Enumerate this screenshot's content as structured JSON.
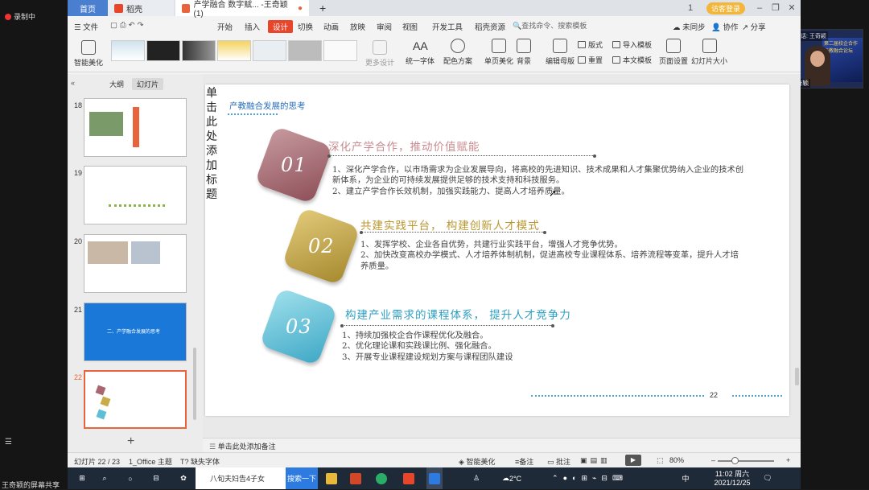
{
  "meeting": {
    "recording_label": "录制中",
    "share_label": "王奇颖的屏幕共享",
    "speaking_label": "正在讲话: 王奇颖",
    "participant_name": "王奇颖",
    "poster_text": "第二届校企合作 产教融合论坛"
  },
  "window": {
    "tabs": [
      "首页",
      "稻壳",
      "产学融合 数字赋... -王奇颖(1)"
    ],
    "login": "访客登录",
    "page_count_badge": "1"
  },
  "menu": {
    "items": [
      "文件",
      "开始",
      "插入",
      "设计",
      "切换",
      "动画",
      "放映",
      "审阅",
      "视图",
      "开发工具",
      "稻壳资源"
    ],
    "search": "查找命令、搜索模板",
    "right": [
      "未同步",
      "协作",
      "分享"
    ]
  },
  "ribbon": {
    "smart": "智能美化",
    "more": "更多设计",
    "font": "统一字体",
    "color": "配色方案",
    "single": "单页美化",
    "bg": "背景",
    "master": "编辑母版",
    "layout": "版式",
    "import": "导入模板",
    "reset": "重置",
    "text_tpl": "本文模板",
    "page_setup": "页面设置",
    "slide_size": "幻灯片大小"
  },
  "pane": {
    "tab_outline": "大纲",
    "tab_slides": "幻灯片",
    "slides": [
      {
        "num": "18"
      },
      {
        "num": "19"
      },
      {
        "num": "20"
      },
      {
        "num": "21",
        "text": "二、产学融合发展的思考"
      },
      {
        "num": "22"
      }
    ]
  },
  "slide": {
    "title_placeholder": "单击此处添加标题",
    "heading": "产教融合发展的思考",
    "sections": [
      {
        "num": "01",
        "title": "深化产学合作，推动价值赋能",
        "lines": [
          "1、深化产学合作，以市场需求为企业发展导向，将高校的先进知识、技术成果和人才集聚优势纳入企业的技术创新体系，为企业的可持续发展提供足够的技术支持和科技服务。",
          "2、建立产学合作长效机制，加强实践能力、提高人才培养质量。"
        ]
      },
      {
        "num": "02",
        "title": "共建实践平台， 构建创新人才模式",
        "lines": [
          "1、发挥学校、企业各自优势，共建行业实践平台，增强人才竞争优势。",
          "2、加快改变高校办学模式、人才培养体制机制，促进高校专业课程体系、培养流程等变革，提升人才培养质量。"
        ]
      },
      {
        "num": "03",
        "title": "构建产业需求的课程体系， 提升人才竞争力",
        "lines": [
          "1、持续加强校企合作课程优化及融合。",
          "2、优化理论课和实践课比例、强化融合。",
          "3、开展专业课程建设规划方案与课程团队建设"
        ]
      }
    ],
    "page_number": "22"
  },
  "notes_placeholder": "单击此处添加备注",
  "status": {
    "slide_pos": "幻灯片 22 / 23",
    "theme": "1_Office 主题",
    "missing_font": "缺失字体",
    "smart": "智能美化",
    "notes": "备注",
    "comment": "批注",
    "zoom": "80%"
  },
  "taskbar": {
    "search_text": "八旬夫妇告4子女",
    "search_btn": "搜索一下",
    "weather": "2°C",
    "ime": "中",
    "time": "11:02 周六",
    "date": "2021/12/25"
  },
  "colors": {
    "accent": "#e8462a",
    "badge1": "#a9666f",
    "badge2": "#c9ab4a",
    "badge3": "#5dbfd6",
    "home_tab": "#4a7fd0"
  }
}
